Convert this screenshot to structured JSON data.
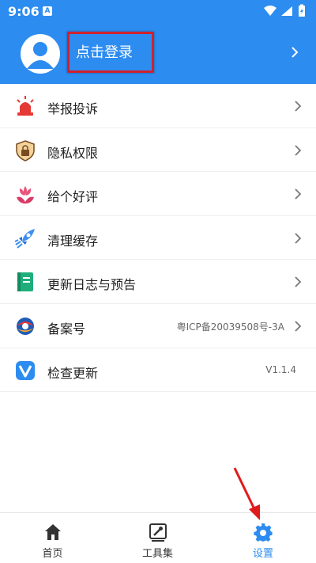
{
  "status_bar": {
    "time": "9:06",
    "notification_letter": "A"
  },
  "header": {
    "login_text": "点击登录"
  },
  "menu": {
    "items": [
      {
        "label": "举报投诉",
        "value": "",
        "icon": "alarm-light-icon"
      },
      {
        "label": "隐私权限",
        "value": "",
        "icon": "shield-lock-icon"
      },
      {
        "label": "给个好评",
        "value": "",
        "icon": "flower-icon"
      },
      {
        "label": "清理缓存",
        "value": "",
        "icon": "rocket-icon"
      },
      {
        "label": "更新日志与预告",
        "value": "",
        "icon": "notebook-icon"
      },
      {
        "label": "备案号",
        "value": "粤ICP备20039508号-3A",
        "icon": "registration-logo-icon"
      },
      {
        "label": "检查更新",
        "value": "V1.1.4",
        "icon": "version-v-icon"
      }
    ]
  },
  "bottom_nav": {
    "home": "首页",
    "tools": "工具集",
    "settings": "设置",
    "active": "settings"
  },
  "colors": {
    "brand": "#2d8cf0",
    "highlight_border": "#d0202c",
    "annotation_arrow": "#e01b1b"
  }
}
